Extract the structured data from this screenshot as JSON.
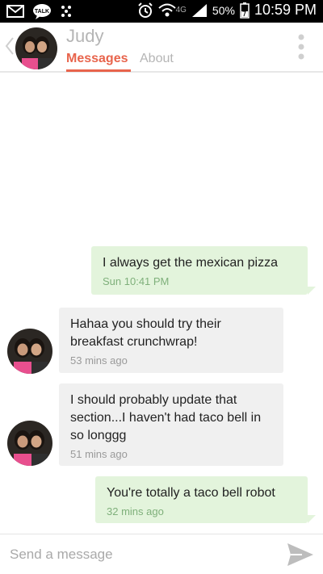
{
  "status_bar": {
    "time": "10:59 PM",
    "battery": "50%",
    "network": "4G",
    "icons": [
      "mail-icon",
      "talk-icon",
      "dots-icon",
      "alarm-icon",
      "wifi-icon",
      "signal-icon",
      "battery-icon"
    ],
    "talk_label": "TALK"
  },
  "header": {
    "name": "Judy",
    "tabs": [
      {
        "label": "Messages",
        "active": true
      },
      {
        "label": "About",
        "active": false
      }
    ],
    "accent_color": "#e8644c"
  },
  "messages": [
    {
      "direction": "sent",
      "text": "I always get the mexican pizza",
      "time": "Sun 10:41 PM"
    },
    {
      "direction": "received",
      "text": "Hahaa you should try their breakfast crunchwrap!",
      "time": "53 mins ago"
    },
    {
      "direction": "received",
      "text": "I should probably update that section...I haven't had taco bell in so longgg",
      "time": "51 mins ago"
    },
    {
      "direction": "sent",
      "text": "You're totally a taco bell robot",
      "time": "32 mins ago"
    }
  ],
  "composer": {
    "placeholder": "Send a message",
    "value": ""
  }
}
